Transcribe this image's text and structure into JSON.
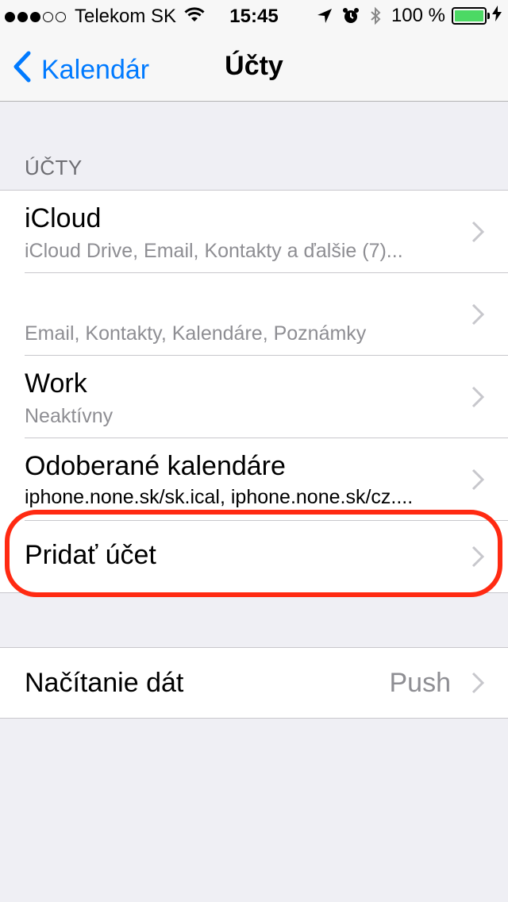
{
  "status_bar": {
    "carrier": "Telekom SK",
    "time": "15:45",
    "battery_percent": "100 %",
    "signal_strength": 3,
    "signal_max": 5,
    "battery_level": 1.0,
    "battery_color": "#4cd964"
  },
  "nav": {
    "back_label": "Kalendár",
    "title": "Účty",
    "accent_color": "#007aff"
  },
  "section": {
    "header": "ÚČTY"
  },
  "accounts": [
    {
      "title": "iCloud",
      "subtitle": "iCloud Drive, Email, Kontakty a ďalšie (7)..."
    },
    {
      "title": "",
      "subtitle": "Email, Kontakty, Kalendáre, Poznámky"
    },
    {
      "title": "Work",
      "subtitle": "Neaktívny"
    },
    {
      "title": "Odoberané kalendáre",
      "subtitle": "iphone.none.sk/sk.ical, iphone.none.sk/cz...."
    }
  ],
  "add_account": {
    "label": "Pridať účet",
    "highlight_color": "#ff2a12"
  },
  "fetch": {
    "label": "Načítanie dát",
    "value": "Push"
  }
}
